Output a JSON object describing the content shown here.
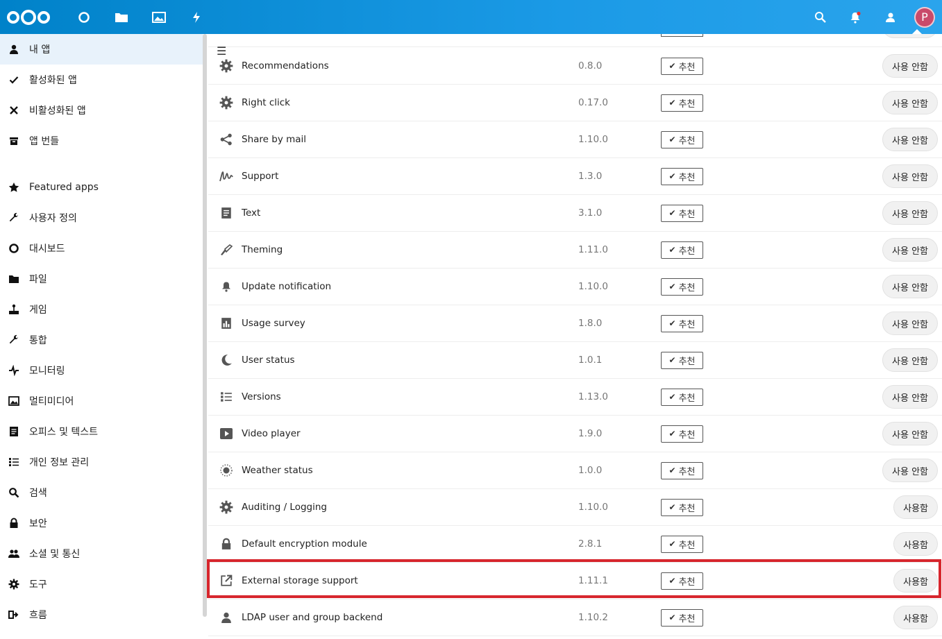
{
  "header": {
    "nav_icons": [
      "dashboard-circle-icon",
      "files-folder-icon",
      "photos-image-icon",
      "activity-bolt-icon"
    ],
    "right_icons": [
      "search-icon",
      "notifications-bell-icon",
      "contacts-icon"
    ],
    "avatar_letter": "P",
    "brand_color": "#0082c9"
  },
  "sidebar": {
    "items": [
      {
        "label": "내 앱",
        "icon": "user-icon",
        "active": true
      },
      {
        "label": "활성화된 앱",
        "icon": "check-icon"
      },
      {
        "label": "비활성화된 앱",
        "icon": "close-icon"
      },
      {
        "label": "앱 번들",
        "icon": "archive-icon"
      }
    ],
    "categories": [
      {
        "label": "Featured apps",
        "icon": "star-icon"
      },
      {
        "label": "사용자 정의",
        "icon": "wrench-icon"
      },
      {
        "label": "대시보드",
        "icon": "circle-icon"
      },
      {
        "label": "파일",
        "icon": "folder-icon"
      },
      {
        "label": "게임",
        "icon": "joystick-icon"
      },
      {
        "label": "통합",
        "icon": "plug-icon"
      },
      {
        "label": "모니터링",
        "icon": "pulse-icon"
      },
      {
        "label": "멀티미디어",
        "icon": "picture-icon"
      },
      {
        "label": "오피스 및 텍스트",
        "icon": "document-icon"
      },
      {
        "label": "개인 정보 관리",
        "icon": "list-icon"
      },
      {
        "label": "검색",
        "icon": "search-icon"
      },
      {
        "label": "보안",
        "icon": "lock-icon"
      },
      {
        "label": "소셜 및 통신",
        "icon": "people-icon"
      },
      {
        "label": "도구",
        "icon": "gear-icon"
      },
      {
        "label": "흐름",
        "icon": "flow-icon"
      }
    ]
  },
  "apps": [
    {
      "name": "Recommendations",
      "version": "0.8.0",
      "recommended": "추천",
      "action": "사용 안함",
      "icon": "gear-icon"
    },
    {
      "name": "Right click",
      "version": "0.17.0",
      "recommended": "추천",
      "action": "사용 안함",
      "icon": "gear-icon"
    },
    {
      "name": "Share by mail",
      "version": "1.10.0",
      "recommended": "추천",
      "action": "사용 안함",
      "icon": "share-icon"
    },
    {
      "name": "Support",
      "version": "1.3.0",
      "recommended": "추천",
      "action": "사용 안함",
      "icon": "signature-icon"
    },
    {
      "name": "Text",
      "version": "3.1.0",
      "recommended": "추천",
      "action": "사용 안함",
      "icon": "document-icon"
    },
    {
      "name": "Theming",
      "version": "1.11.0",
      "recommended": "추천",
      "action": "사용 안함",
      "icon": "brush-icon"
    },
    {
      "name": "Update notification",
      "version": "1.10.0",
      "recommended": "추천",
      "action": "사용 안함",
      "icon": "bell-icon"
    },
    {
      "name": "Usage survey",
      "version": "1.8.0",
      "recommended": "추천",
      "action": "사용 안함",
      "icon": "chart-icon"
    },
    {
      "name": "User status",
      "version": "1.0.1",
      "recommended": "추천",
      "action": "사용 안함",
      "icon": "moon-icon"
    },
    {
      "name": "Versions",
      "version": "1.13.0",
      "recommended": "추천",
      "action": "사용 안함",
      "icon": "list-icon"
    },
    {
      "name": "Video player",
      "version": "1.9.0",
      "recommended": "추천",
      "action": "사용 안함",
      "icon": "play-icon"
    },
    {
      "name": "Weather status",
      "version": "1.0.0",
      "recommended": "추천",
      "action": "사용 안함",
      "icon": "sun-icon"
    },
    {
      "name": "Auditing / Logging",
      "version": "1.10.0",
      "recommended": "추천",
      "action": "사용함",
      "icon": "gear-icon"
    },
    {
      "name": "Default encryption module",
      "version": "2.8.1",
      "recommended": "추천",
      "action": "사용함",
      "icon": "lock-icon"
    },
    {
      "name": "External storage support",
      "version": "1.11.1",
      "recommended": "추천",
      "action": "사용함",
      "icon": "external-link-icon"
    },
    {
      "name": "LDAP user and group backend",
      "version": "1.10.2",
      "recommended": "추천",
      "action": "사용함",
      "icon": "user-icon"
    }
  ],
  "highlight_color": "#d7262d"
}
